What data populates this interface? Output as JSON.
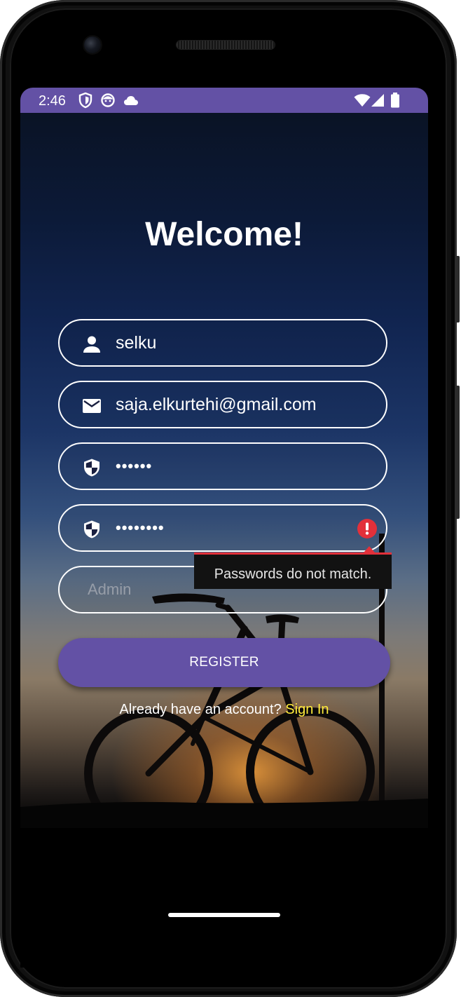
{
  "status_bar": {
    "time": "2:46",
    "left_icons": [
      "shield-icon",
      "face-icon",
      "cloud-icon"
    ],
    "right_icons": [
      "wifi-icon",
      "cellular-signal-icon",
      "battery-icon"
    ],
    "color": "#6351a5"
  },
  "screen": {
    "title": "Welcome!"
  },
  "form": {
    "username": {
      "value": "selku",
      "icon": "person-icon"
    },
    "email": {
      "value": "saja.elkurtehi@gmail.com",
      "icon": "email-icon"
    },
    "password": {
      "value": "••••••",
      "icon": "shield-icon"
    },
    "confirm_password": {
      "value": "••••••••",
      "icon": "shield-icon",
      "error_icon": "error-icon"
    },
    "role": {
      "placeholder": "Admin"
    },
    "error_message": "Passwords do not match.",
    "register_label": "REGISTER"
  },
  "footer": {
    "prompt": "Already have an account?",
    "link": "Sign In",
    "link_color": "#ffeb3b"
  },
  "colors": {
    "accent": "#6351a5",
    "error": "#e2303a"
  }
}
